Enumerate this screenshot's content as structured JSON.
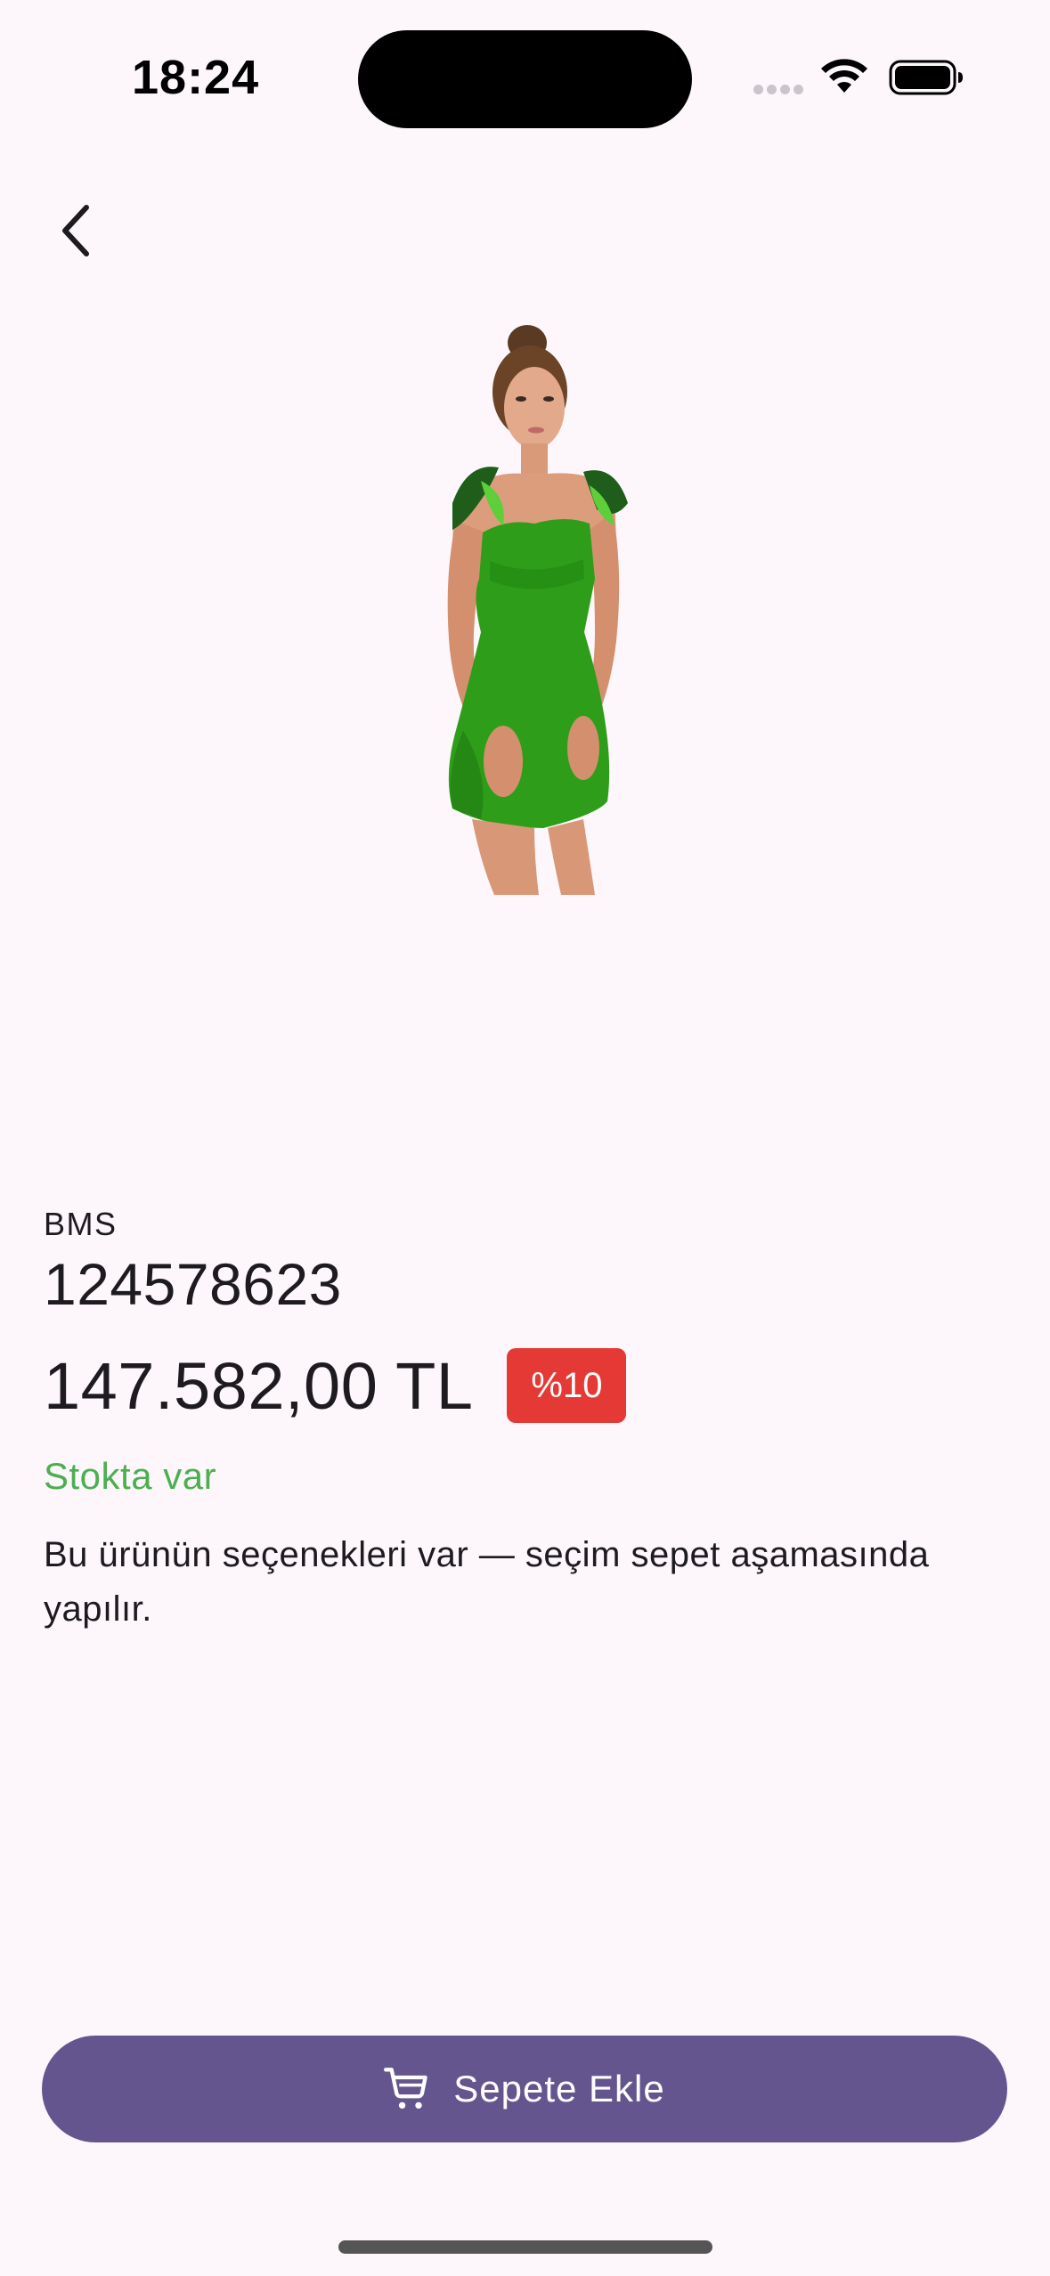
{
  "status_bar": {
    "time": "18:24"
  },
  "nav": {
    "back_icon": "chevron-left-icon"
  },
  "product": {
    "brand": "BMS",
    "title": "124578623",
    "price": "147.582,00 TL",
    "discount": "%10",
    "stock_status": "Stokta var",
    "options_note": "Bu ürünün seçenekleri var — seçim sepet aşamasında yapılır."
  },
  "actions": {
    "add_to_cart_label": "Sepete Ekle",
    "add_to_cart_icon": "cart-icon"
  },
  "colors": {
    "background": "#fdf7fc",
    "primary_button": "#65558f",
    "discount_badge": "#e53935",
    "in_stock": "#4caf50"
  }
}
